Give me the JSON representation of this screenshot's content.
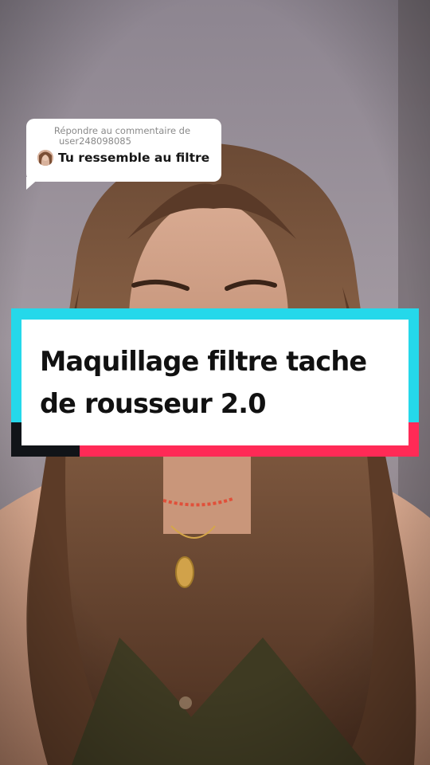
{
  "reply": {
    "header_line1": "Répondre au commentaire de",
    "header_line2": "user248098085",
    "comment": "Tu ressemble au filtre",
    "avatar_icon": "user-avatar"
  },
  "caption": {
    "line1": "Maquillage filtre tache",
    "line2": "de rousseur 2.0"
  },
  "colors": {
    "banner_cyan": "#25d8ea",
    "banner_pink": "#ff2a56",
    "banner_dark": "#111418",
    "bubble_bg": "#ffffff"
  }
}
